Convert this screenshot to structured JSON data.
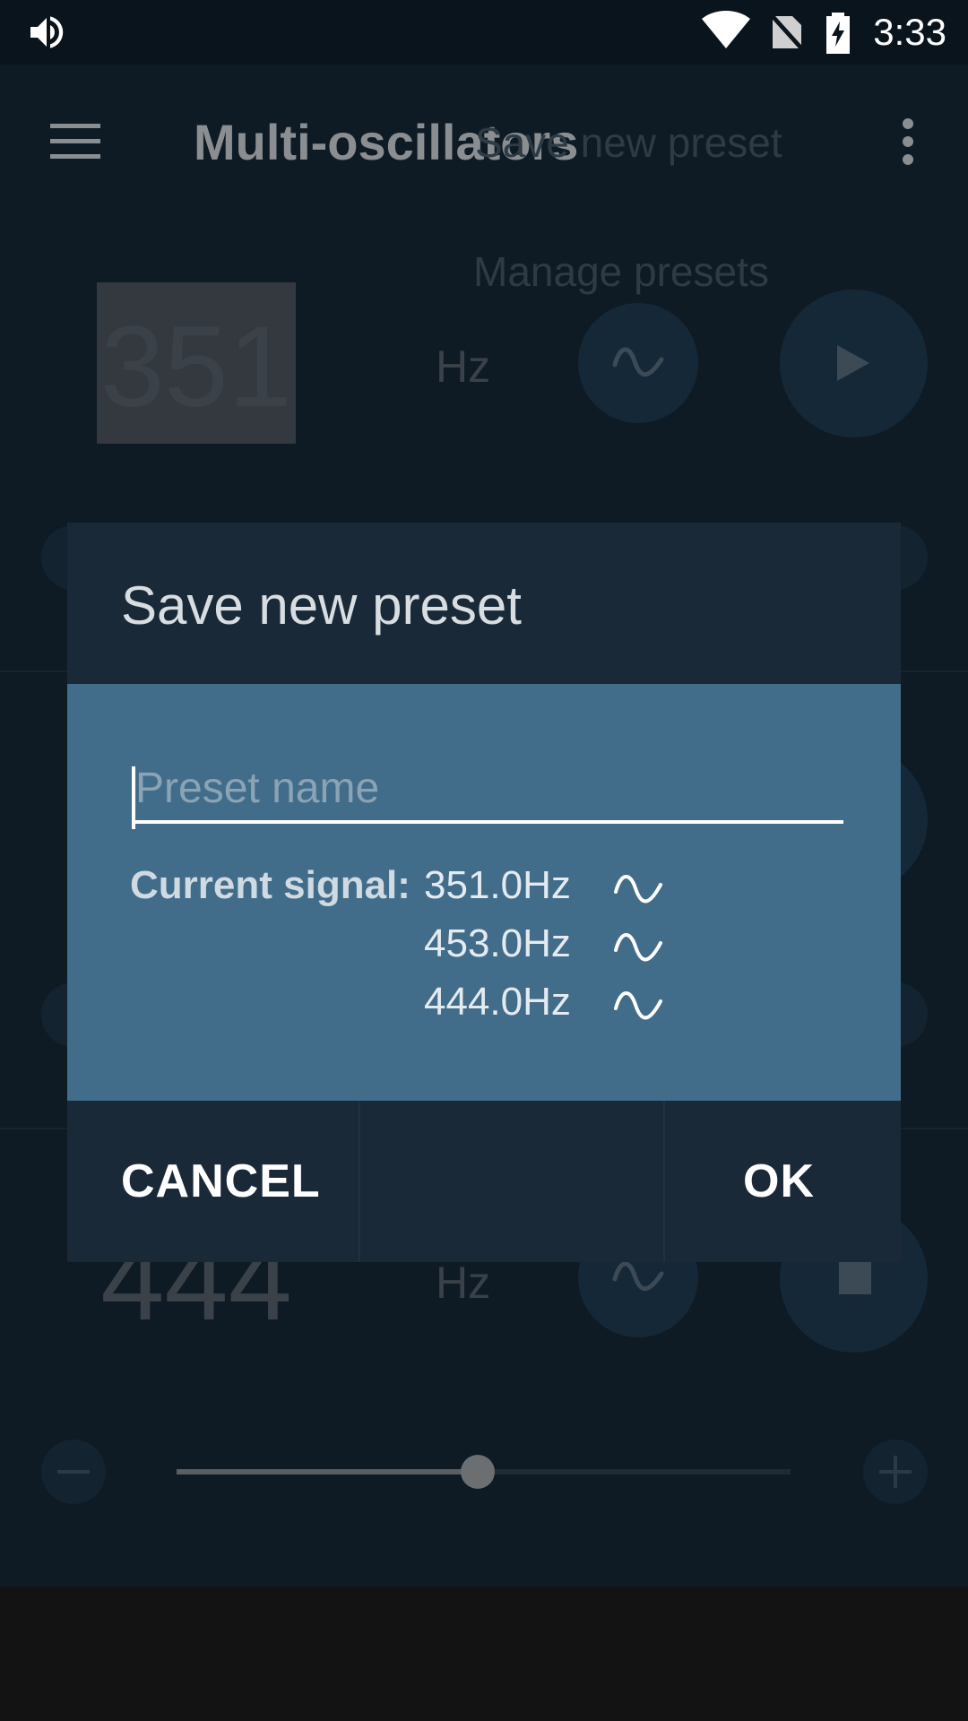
{
  "status": {
    "time": "3:33"
  },
  "appbar": {
    "title": "Multi-oscillators"
  },
  "overflow_menu": {
    "items": [
      "Save new preset",
      "Manage presets"
    ]
  },
  "oscillators": [
    {
      "frequency": "351",
      "unit": "Hz"
    },
    {
      "frequency": "444",
      "unit": "Hz"
    }
  ],
  "slider": {
    "level": 0.49
  },
  "dialog": {
    "title": "Save new preset",
    "input_placeholder": "Preset name",
    "input_value": "",
    "signal_label": "Current signal:",
    "signals": [
      "351.0Hz",
      "453.0Hz",
      "444.0Hz"
    ],
    "cancel": "CANCEL",
    "ok": "OK"
  },
  "colors": {
    "dialog_body": "#426d8a",
    "dialog_frame": "#192938",
    "background": "#0e1b25"
  }
}
